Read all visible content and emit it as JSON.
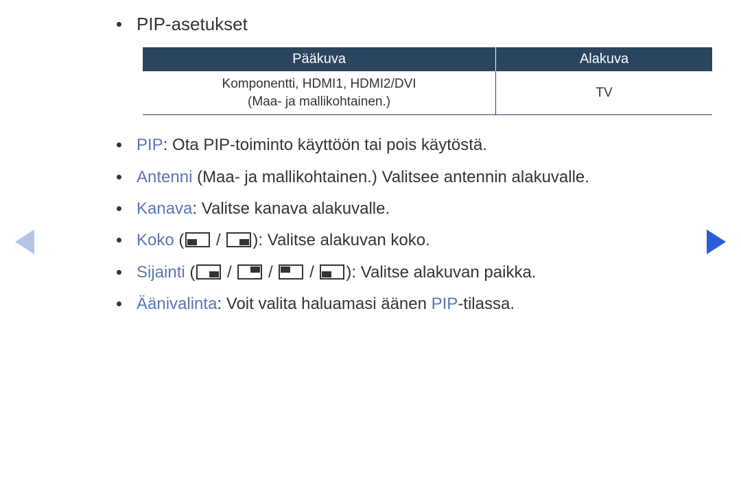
{
  "title": "PIP-asetukset",
  "table": {
    "headers": [
      "Pääkuva",
      "Alakuva"
    ],
    "row": {
      "main_line1": "Komponentti, HDMI1, HDMI2/DVI",
      "main_line2": "(Maa- ja mallikohtainen.)",
      "sub": "TV"
    }
  },
  "items": {
    "pip": {
      "kw": "PIP",
      "text": ": Ota PIP-toiminto käyttöön tai pois käytöstä."
    },
    "antenni": {
      "kw": "Antenni",
      "text": " (Maa- ja mallikohtainen.) Valitsee antennin alakuvalle."
    },
    "kanava": {
      "kw": "Kanava",
      "text": ": Valitse kanava alakuvalle."
    },
    "koko": {
      "kw": "Koko",
      "before": " (",
      "sep": " / ",
      "after": "): Valitse alakuvan koko."
    },
    "sijainti": {
      "kw": "Sijainti",
      "before": " (",
      "sep": " / ",
      "after": "): Valitse alakuvan paikka."
    },
    "aani": {
      "kw": "Äänivalinta",
      "text1": ": Voit valita haluamasi äänen ",
      "kw2": "PIP",
      "text2": "-tilassa."
    }
  }
}
